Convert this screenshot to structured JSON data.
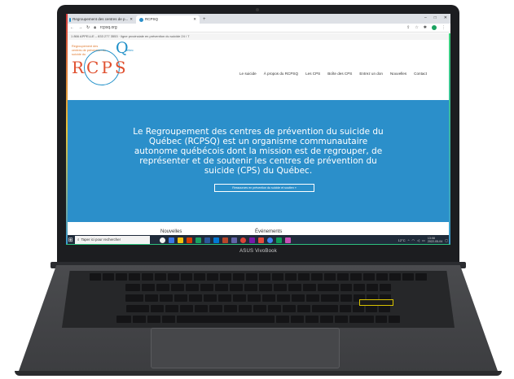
{
  "browser": {
    "tabs": [
      {
        "label": "Regroupement des centres de p..."
      },
      {
        "label": "RCPSQ"
      }
    ],
    "url": "rcpsq.org",
    "window_controls": [
      "–",
      "□",
      "✕"
    ]
  },
  "page": {
    "helpline": "1 866 APPELLE – 833 277 3553 · ligne provinciale en prévention du suicide 24 / 7",
    "logo": {
      "small_text": "Regroupement des centres de prévention du suicide du",
      "letters": "RCPS",
      "q_letter": "Q",
      "q_sub": "uébec"
    },
    "nav": [
      "Le suicide",
      "À propos du RCPSQ",
      "Les CPS",
      "Boîte des CPS",
      "Entrez un don",
      "Nouvelles",
      "Contact"
    ],
    "hero": {
      "text": "Le Regroupement des centres de prévention du suicide du Québec (RCPSQ) est un organisme communautaire autonome québécois dont la mission est de regrouper, de représenter et de soutenir les centres de prévention du suicide (CPS) du Québec.",
      "button_label": "Ressources en prévention du suicide et soutien »"
    },
    "below": [
      "Nouvelles",
      "Événements"
    ]
  },
  "taskbar": {
    "search_placeholder": "Taper ici pour rechercher",
    "clock": "13:08",
    "date": "2022-05-04",
    "weather": "12°C"
  },
  "laptop": {
    "brand": "ASUS VivoBook"
  },
  "colors": {
    "hero": "#2b8fca",
    "logo_orange": "#e0502f",
    "logo_blue": "#1e8fc8",
    "taskbar": "#202b3a"
  }
}
